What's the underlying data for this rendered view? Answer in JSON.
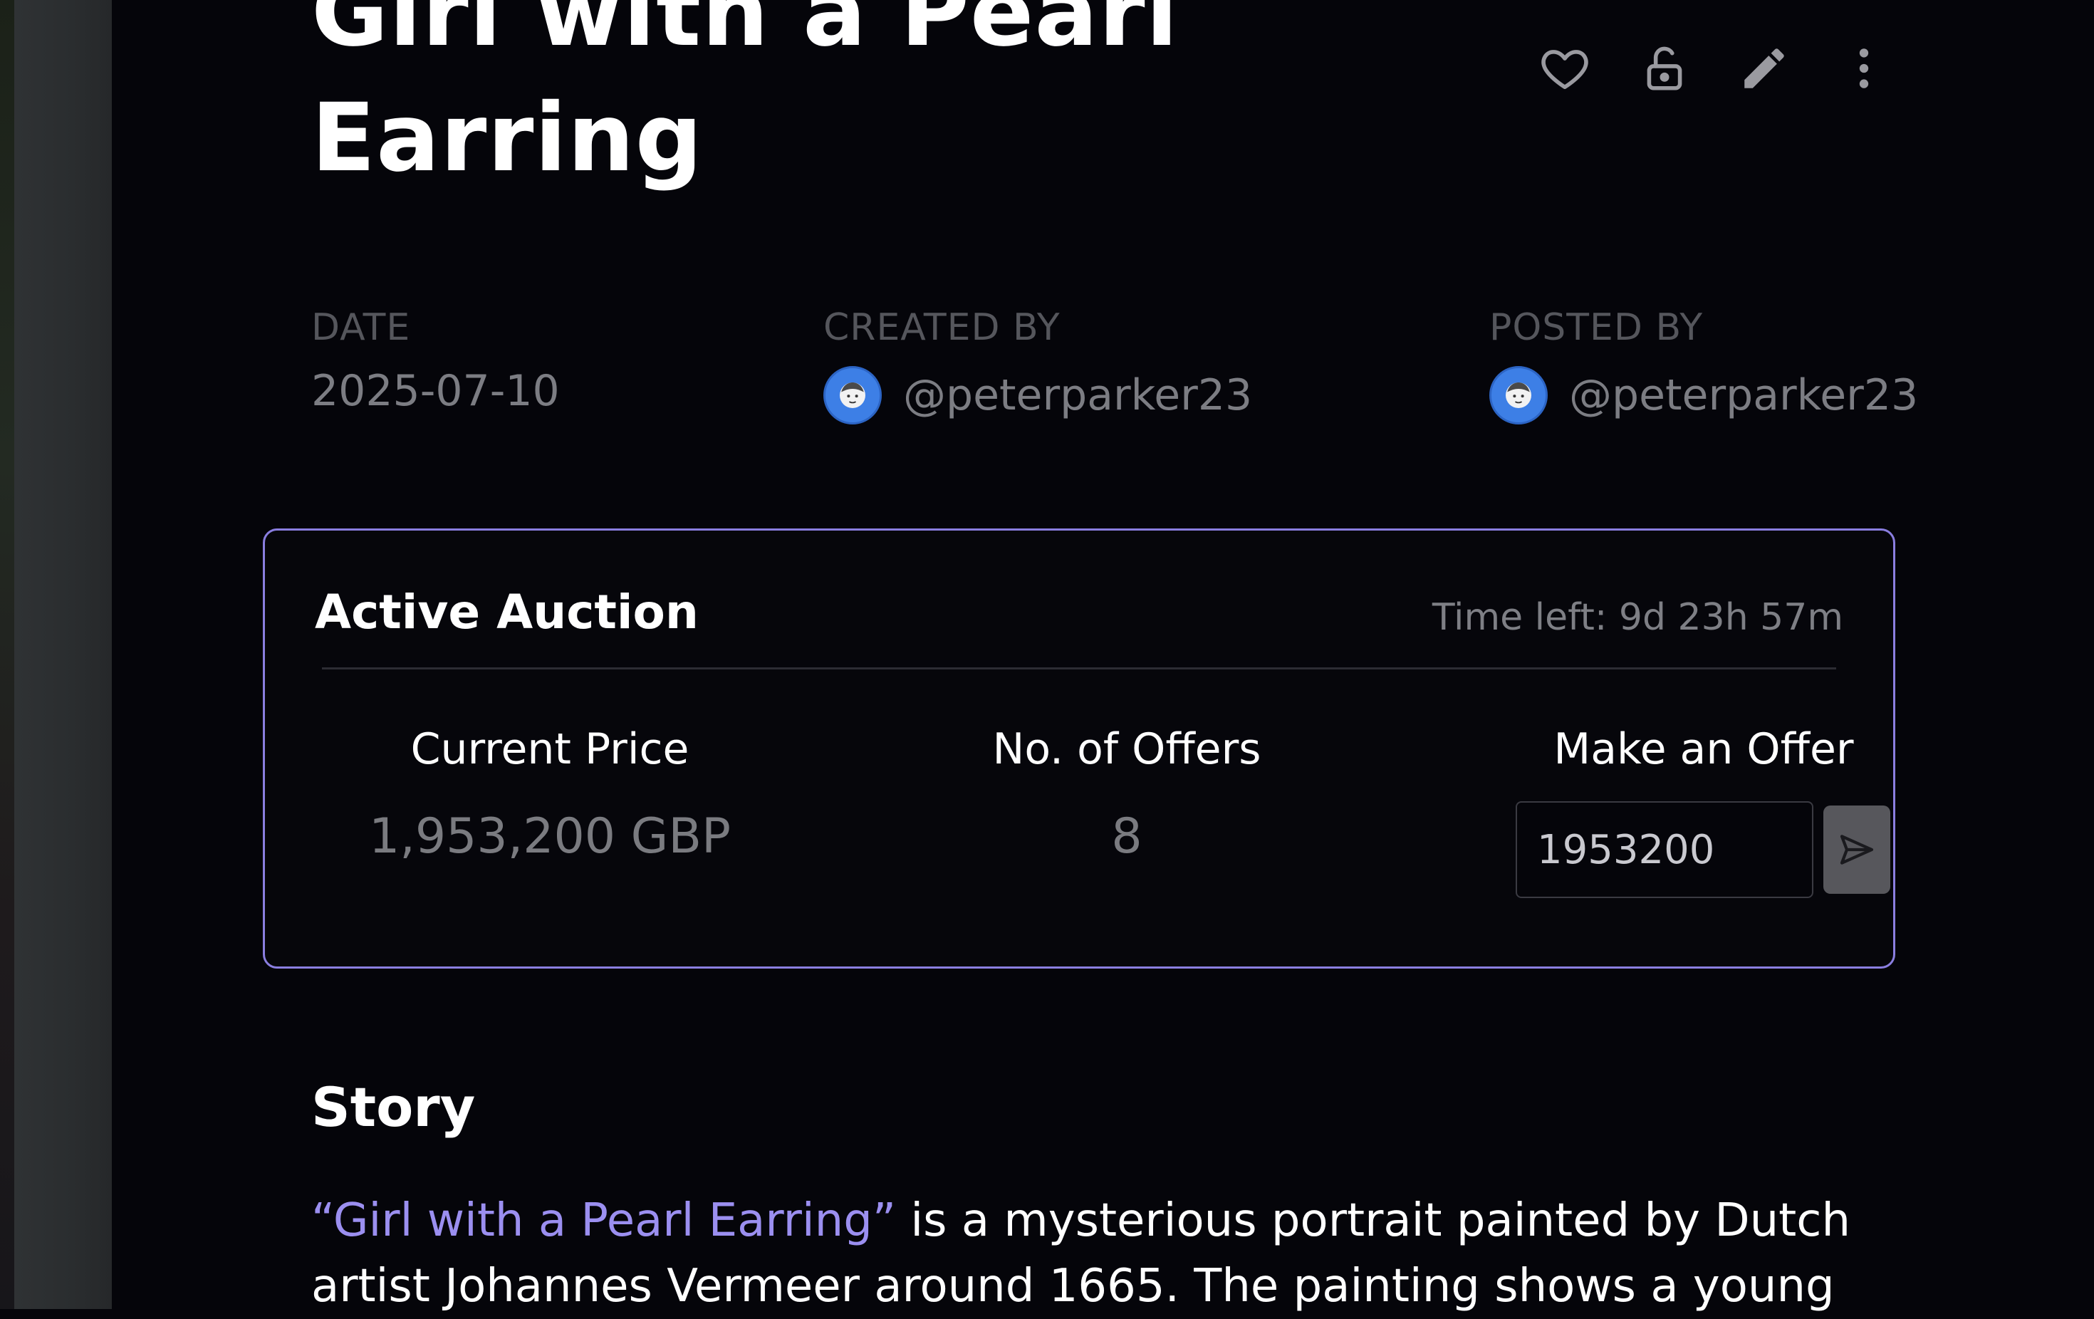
{
  "artwork": {
    "title": "Girl with a Pearl Earring"
  },
  "actions": [
    {
      "name": "favorite",
      "icon": "heart-icon"
    },
    {
      "name": "lock",
      "icon": "unlock-icon"
    },
    {
      "name": "edit",
      "icon": "pencil-icon"
    },
    {
      "name": "more",
      "icon": "more-vertical-icon"
    }
  ],
  "meta": {
    "date_label": "DATE",
    "date_value": "2025-07-10",
    "created_by_label": "CREATED BY",
    "created_by_user": "@peterparker23",
    "posted_by_label": "POSTED BY",
    "posted_by_user": "@peterparker23"
  },
  "auction": {
    "title": "Active Auction",
    "time_left": "Time left: 9d 23h 57m",
    "current_price_label": "Current Price",
    "current_price_value": "1,953,200 GBP",
    "offers_label": "No. of Offers",
    "offers_value": "8",
    "make_offer_label": "Make an Offer",
    "offer_input_value": "1953200",
    "accent_color": "#8a7ee0"
  },
  "story": {
    "heading": "Story",
    "link_text": "“Girl with a Pearl Earring”",
    "text": " is a mysterious portrait painted by Dutch artist Johannes Vermeer around 1665. The painting shows a young",
    "link_color": "#9b8ff0"
  }
}
